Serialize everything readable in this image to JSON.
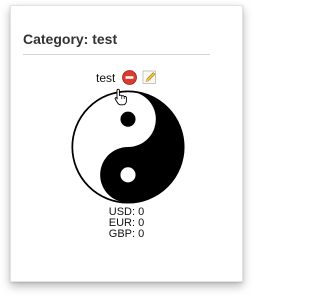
{
  "page": {
    "title": "Category: test"
  },
  "category": {
    "name": "test",
    "icons": [
      "delete-icon",
      "edit-pencil-icon",
      "hand-pointer-cursor-icon",
      "yin-yang-icon"
    ]
  },
  "currencies": [
    {
      "code": "USD",
      "amount": "0",
      "text": "USD: 0"
    },
    {
      "code": "EUR",
      "amount": "0",
      "text": "EUR: 0"
    },
    {
      "code": "GBP",
      "amount": "0",
      "text": "GBP: 0"
    }
  ],
  "colors": {
    "delete_red": "#d93c2f",
    "pencil_yellow": "#f2c230",
    "yin_black": "#000000",
    "yang_white": "#ffffff"
  }
}
